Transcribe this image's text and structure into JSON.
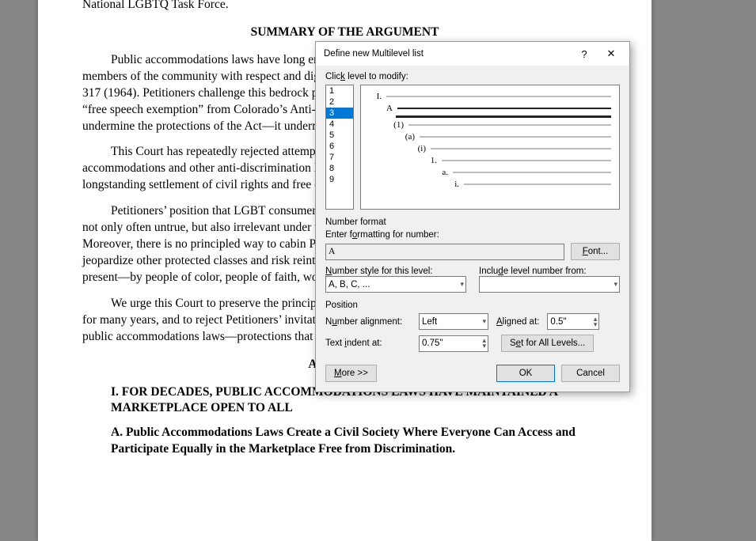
{
  "doc": {
    "line0": "National LGBTQ Task Force.",
    "head1": "SUMMARY OF THE ARGUMENT",
    "p1": "Public accommodations laws have long ensured that consumers can access the marketplace as equal members of the community with respect and dignity. Heart of Atlanta Motel, Inc. v. U.S., 378 U.S. 226, 317 (1964). Petitioners challenge this bedrock principle of equal treatment by seeking an unprecedented “free speech exemption” from Colorado’s Anti-Discrimination Act (“CADA”). This does not just undermine the protections of the Act—it undermines them for LGBT people. It undermines them for all.",
    "p2": "This Court has repeatedly rejected attempts to use the First Amendment to carve holes in public accommodations and other anti-discrimination laws. There is no reason here to depart from this longstanding settlement of civil rights and free expression in our shared commercial marketplaces.",
    "p3": "Petitioners’ position that LGBT consumers can simply go elsewhere to obtain goods and services is not only often untrue, but also irrelevant under this Court’s longstanding public accommodations laws. Moreover, there is no principled way to cabin Petitioners’ proposed exemption, which would equally jeopardize other protected classes and risk reintroducing the harm experienced in the past—and sometimes present—by people of color, people of faith, women, and others.",
    "p4": "We urge this Court to preserve the principle of full and equal access that has protected these groups for many years, and to reject Petitioners’ invitation to sanction and undo the protections provided by public accommodations laws—protections that can be erased through the First Amendment.",
    "head2": "ARGUMENT",
    "ol1": "I.       FOR    DECADES,    PUBLIC  ACCOMMODATIONS LAWS HAVE MAINTAINED A MARKETPLACE OPEN TO ALL",
    "ol2": "A. Public Accommodations Laws Create a Civil Society Where Everyone Can Access and Participate Equally in the Marketplace Free from Discrimination."
  },
  "dialog": {
    "title": "Define new Multilevel list",
    "help": "?",
    "close": "✕",
    "click_level": "Click level to modify:",
    "levels": [
      "1",
      "2",
      "3",
      "4",
      "5",
      "6",
      "7",
      "8",
      "9"
    ],
    "selected_level_index": 2,
    "preview_labels": [
      "I.",
      "A",
      "(1)",
      "(a)",
      "(i)",
      "1.",
      "a.",
      "i."
    ],
    "number_format_h": "Number format",
    "enter_formatting": "Enter formatting for number:",
    "format_value": "A",
    "font_btn": "Font...",
    "style_label": "Number style for this level:",
    "style_value": "A, B, C, ...",
    "include_label": "Include level number from:",
    "include_value": "",
    "position_h": "Position",
    "align_label": "Number alignment:",
    "align_value": "Left",
    "aligned_at_label": "Aligned at:",
    "aligned_at_value": "0.5\"",
    "indent_label": "Text indent at:",
    "indent_value": "0.75\"",
    "set_all": "Set for All Levels...",
    "more": "More >>",
    "ok": "OK",
    "cancel": "Cancel"
  }
}
